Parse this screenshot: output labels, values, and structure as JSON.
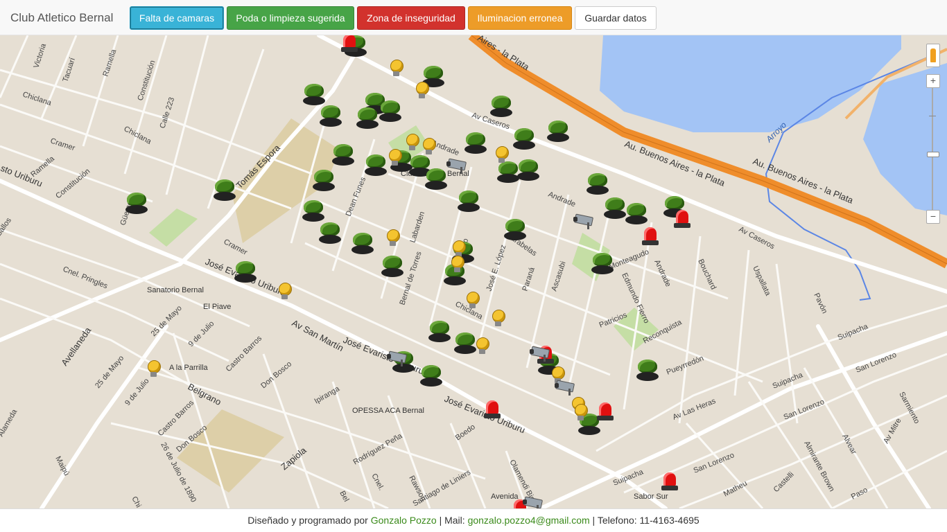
{
  "navbar": {
    "brand": "Club Atletico Bernal",
    "buttons": {
      "camaras": "Falta de camaras",
      "poda": "Poda o limpieza sugerida",
      "inseguridad": "Zona de inseguridad",
      "iluminacion": "Iluminacion erronea",
      "guardar": "Guardar datos"
    }
  },
  "map": {
    "streets": {
      "buenos_aires_la_plata_1": "Au. Buenos Aires - la Plata",
      "buenos_aires_la_plata_2": "Au. Buenos Aires - la Plata",
      "aires_la_plata": "Aires - la Plata",
      "arroyo": "Arroyo",
      "av_caseros_top": "Av Caseros",
      "av_caseros_right": "Av Caseros",
      "andrade_1": "Andrade",
      "andrade_2": "Andrade",
      "andrade_3": "Andrade",
      "jose_evaristo_uriburu_1": "José Evaristo Uriburu",
      "jose_evaristo_uriburu_2": "José Evaristo Uriburu",
      "jose_evaristo_uriburu_3": "José Evaristo Uriburu",
      "av_san_martin": "Av San Martín",
      "tomas_espora": "Tomás Espora",
      "dean_funes": "Dean Funes",
      "labarden": "Labarden",
      "bernal_de_torres": "Bernal de Torres",
      "jose_e_lopez": "José E. López",
      "parana": "Paraná",
      "ascasubi": "Ascasubi",
      "carabelas": "Carabelas",
      "monteagudo": "Monteagudo",
      "edmundo_fierro": "Edmundo Fierro",
      "patricios": "Patricios",
      "reconquista": "Reconquista",
      "pueyrredon": "Pueyrredón",
      "bouchard": "Bouchard",
      "uspallata": "Uspallata",
      "pavon": "Pavón",
      "suipacha_1": "Suipacha",
      "suipacha_2": "Suipacha",
      "suipacha_3": "Suipacha",
      "san_lorenzo_1": "San Lorenzo",
      "san_lorenzo_2": "San Lorenzo",
      "san_lorenzo_3": "San Lorenzo",
      "av_las_heras": "Av Las Heras",
      "sarmiento": "Sarmiento",
      "av_mitre": "Av Mitre",
      "alvear": "Alvear",
      "almirante_brown": "Almirante Brown",
      "castelli": "Castelli",
      "matheu": "Matheu",
      "paso": "Paso",
      "chiclana_1": "Chiclana",
      "chiclana_2": "Chiclana",
      "chiclana_3": "Chiclana",
      "victoria": "Victoria",
      "tacuari": "Tacuarí",
      "ramella_1": "Ramella",
      "ramella_2": "Ramella",
      "constitucion_1": "Constitución",
      "constitucion_2": "Constitución",
      "calle_223": "Calle 223",
      "cramer_1": "Cramer",
      "cramer_2": "Cramer",
      "sto_uriburu": "sto Uriburu",
      "cnel_pringles": "Cnel. Pringles",
      "avellaneda": "Avellaneda",
      "mayo_25_1": "25 de Mayo",
      "mayo_25_2": "25 de Mayo",
      "julio_9_1": "9 de Julio",
      "julio_9_2": "9 de Julio",
      "castro_barros_1": "Castro Barros",
      "castro_barros_2": "Castro Barros",
      "don_bosco_1": "Don Bosco",
      "don_bosco_2": "Don Bosco",
      "belgrano": "Belgrano",
      "ipiranga": "Ipiranga",
      "boedo": "Boedo",
      "zapiola": "Zapiola",
      "rodriguez_pena": "Rodríguez Peña",
      "rawson": "Rawson",
      "cnel": "Cnel.",
      "olamendi": "Olamendi Bis",
      "santiago_liniers": "Santiago de Liniers",
      "julio_26": "26 de Julio de 1890",
      "maipu": "Maipú",
      "alameda": "Alameda",
      "belo": "Bel",
      "ballos": "ballos",
      "guemes": "Güemes",
      "chi": "Chi",
      "moreno": "Moreno"
    },
    "pois": {
      "sanatorio": "Sanatorio Bernal",
      "el_piave": "El Piave",
      "a_la_parrilla": "A la Parrilla",
      "opessa": "OPESSA ACA Bernal",
      "avenida": "Avenida",
      "sabor_sur": "Sabor Sur",
      "club": "Club",
      "bernal": "Bernal"
    }
  },
  "footer": {
    "prefix": "Diseñado y programado por ",
    "author": "Gonzalo Pozzo",
    "mail_label": " | Mail: ",
    "mail": "gonzalo.pozzo4@gmail.com",
    "phone_label": " | Telefono: 11-4163-4695"
  }
}
